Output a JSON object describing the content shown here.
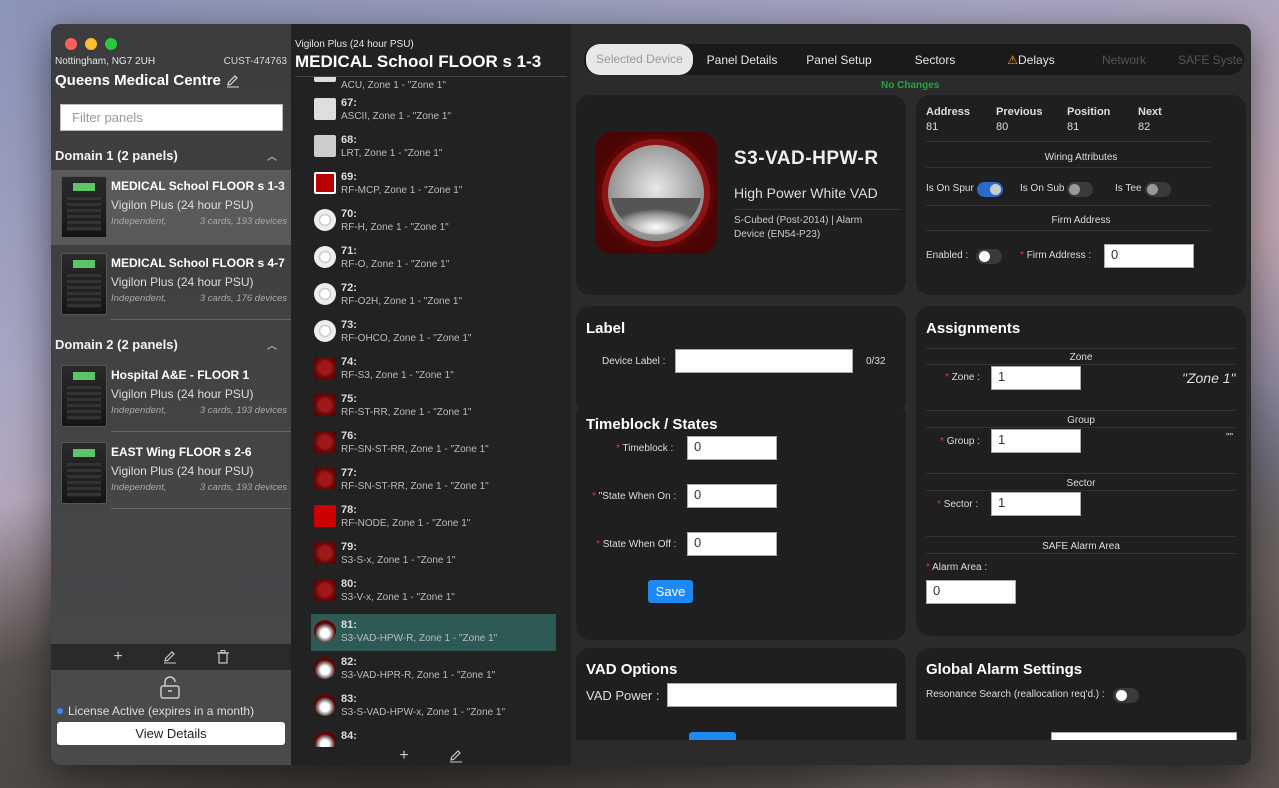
{
  "sidebar": {
    "location": "Nottingham, NG7 2UH",
    "customer_id": "CUST-474763",
    "site_name": "Queens Medical Centre",
    "filter_placeholder": "Filter panels",
    "domains": [
      {
        "label": "Domain 1 (2 panels)"
      },
      {
        "label": "Domain 2 (2 panels)"
      }
    ],
    "panels": [
      {
        "title": "MEDICAL School FLOOR s 1-3",
        "subtitle": "Vigilon Plus (24 hour PSU)",
        "mode": "Independent,",
        "meta": "3 cards, 193 devices"
      },
      {
        "title": "MEDICAL School FLOOR s 4-7",
        "subtitle": "Vigilon Plus (24 hour PSU)",
        "mode": "Independent,",
        "meta": "3 cards, 176 devices"
      },
      {
        "title": "Hospital A&E - FLOOR 1",
        "subtitle": "Vigilon Plus (24 hour PSU)",
        "mode": "Independent,",
        "meta": "3 cards, 193 devices"
      },
      {
        "title": "EAST Wing FLOOR s 2-6",
        "subtitle": "Vigilon Plus (24 hour PSU)",
        "mode": "Independent,",
        "meta": "3 cards, 193 devices"
      }
    ],
    "license_text": "License Active (expires in a month)",
    "view_details_label": "View Details"
  },
  "device_list": {
    "panel_type": "Vigilon Plus (24 hour PSU)",
    "panel_name": "MEDICAL School FLOOR s 1-3",
    "devices": [
      {
        "num": "",
        "desc": "ACU, Zone 1 - \"Zone 1\""
      },
      {
        "num": "67:",
        "desc": "ASCII, Zone 1 - \"Zone 1\""
      },
      {
        "num": "68:",
        "desc": "LRT, Zone 1 - \"Zone 1\""
      },
      {
        "num": "69:",
        "desc": "RF-MCP, Zone 1 - \"Zone 1\""
      },
      {
        "num": "70:",
        "desc": "RF-H, Zone 1 - \"Zone 1\""
      },
      {
        "num": "71:",
        "desc": "RF-O, Zone 1 - \"Zone 1\""
      },
      {
        "num": "72:",
        "desc": "RF-O2H, Zone 1 - \"Zone 1\""
      },
      {
        "num": "73:",
        "desc": "RF-OHCO, Zone 1 - \"Zone 1\""
      },
      {
        "num": "74:",
        "desc": "RF-S3, Zone 1 - \"Zone 1\""
      },
      {
        "num": "75:",
        "desc": "RF-ST-RR, Zone 1 - \"Zone 1\""
      },
      {
        "num": "76:",
        "desc": "RF-SN-ST-RR, Zone 1 - \"Zone 1\""
      },
      {
        "num": "77:",
        "desc": "RF-SN-ST-RR, Zone 1 - \"Zone 1\""
      },
      {
        "num": "78:",
        "desc": "RF-NODE, Zone 1 - \"Zone 1\""
      },
      {
        "num": "79:",
        "desc": "S3-S-x, Zone 1 - \"Zone 1\""
      },
      {
        "num": "80:",
        "desc": "S3-V-x, Zone 1 - \"Zone 1\""
      },
      {
        "num": "81:",
        "desc": "S3-VAD-HPW-R, Zone 1 - \"Zone 1\""
      },
      {
        "num": "82:",
        "desc": "S3-VAD-HPR-R, Zone 1 - \"Zone 1\""
      },
      {
        "num": "83:",
        "desc": "S3-S-VAD-HPW-x, Zone 1 - \"Zone 1\""
      },
      {
        "num": "84:",
        "desc": ""
      }
    ]
  },
  "tabs": [
    "Selected Device",
    "Panel Details",
    "Panel Setup",
    "Sectors",
    "Delays",
    "Network",
    "SAFE Syste"
  ],
  "status": "No Changes",
  "device": {
    "code": "S3-VAD-HPW-R",
    "name": "High Power White VAD",
    "description": "S-Cubed (Post-2014) | Alarm Device (EN54-P23)"
  },
  "address_card": {
    "headers": [
      "Address",
      "Previous",
      "Position",
      "Next"
    ],
    "values": [
      "81",
      "80",
      "81",
      "82"
    ],
    "wiring_title": "Wiring Attributes",
    "on_spur_label": "Is On Spur",
    "on_sub_label": "Is On Sub",
    "is_tee_label": "Is Tee",
    "firm_title": "Firm Address",
    "enabled_label": "Enabled",
    "firm_address_label": "Firm Address",
    "firm_address_value": "0"
  },
  "label_card": {
    "title": "Label",
    "device_label": "Device Label",
    "device_label_value": "",
    "counter": "0/32"
  },
  "timeblock_card": {
    "title": "Timeblock / States",
    "timeblock_label": "Timeblock",
    "timeblock_value": "0",
    "state_on_label": "\"State When On",
    "state_on_value": "0",
    "state_off_label": "State When Off",
    "state_off_value": "0",
    "save_label": "Save"
  },
  "assignments": {
    "title": "Assignments",
    "zone_title": "Zone",
    "zone_label": "Zone",
    "zone_value": "1",
    "zone_name": "\"Zone 1\"",
    "group_title": "Group",
    "group_label": "Group",
    "group_value": "1",
    "group_name": "\"\"",
    "sector_title": "Sector",
    "sector_label": "Sector",
    "sector_value": "1",
    "safe_title": "SAFE Alarm Area",
    "alarm_area_label": "Alarm Area",
    "alarm_area_value": "0"
  },
  "vad_card": {
    "title": "VAD Options",
    "power_label": "VAD Power",
    "power_value": ""
  },
  "global_card": {
    "title": "Global Alarm Settings",
    "resonance_label": "Resonance Search (reallocation req'd.)"
  },
  "colors": {
    "accent": "#1e88f3",
    "selected_row": "#2d5a55",
    "status_green": "#1faa3a",
    "required": "#e33"
  }
}
